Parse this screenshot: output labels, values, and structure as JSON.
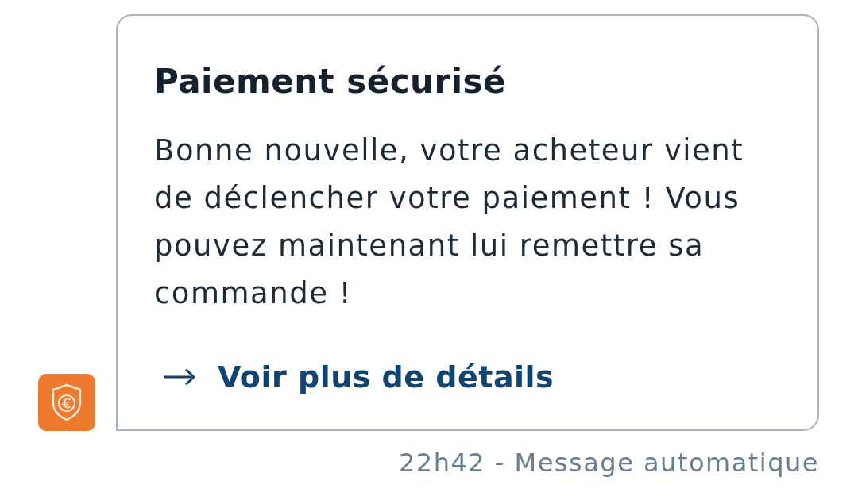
{
  "message": {
    "title": "Paiement sécurisé",
    "body": "Bonne nouvelle, votre acheteur vient de déclencher votre paiement ! Vous pouvez maintenant lui remettre sa commande !",
    "link": {
      "label": "Voir plus de détails"
    }
  },
  "meta": "22h42 - Message automatique"
}
